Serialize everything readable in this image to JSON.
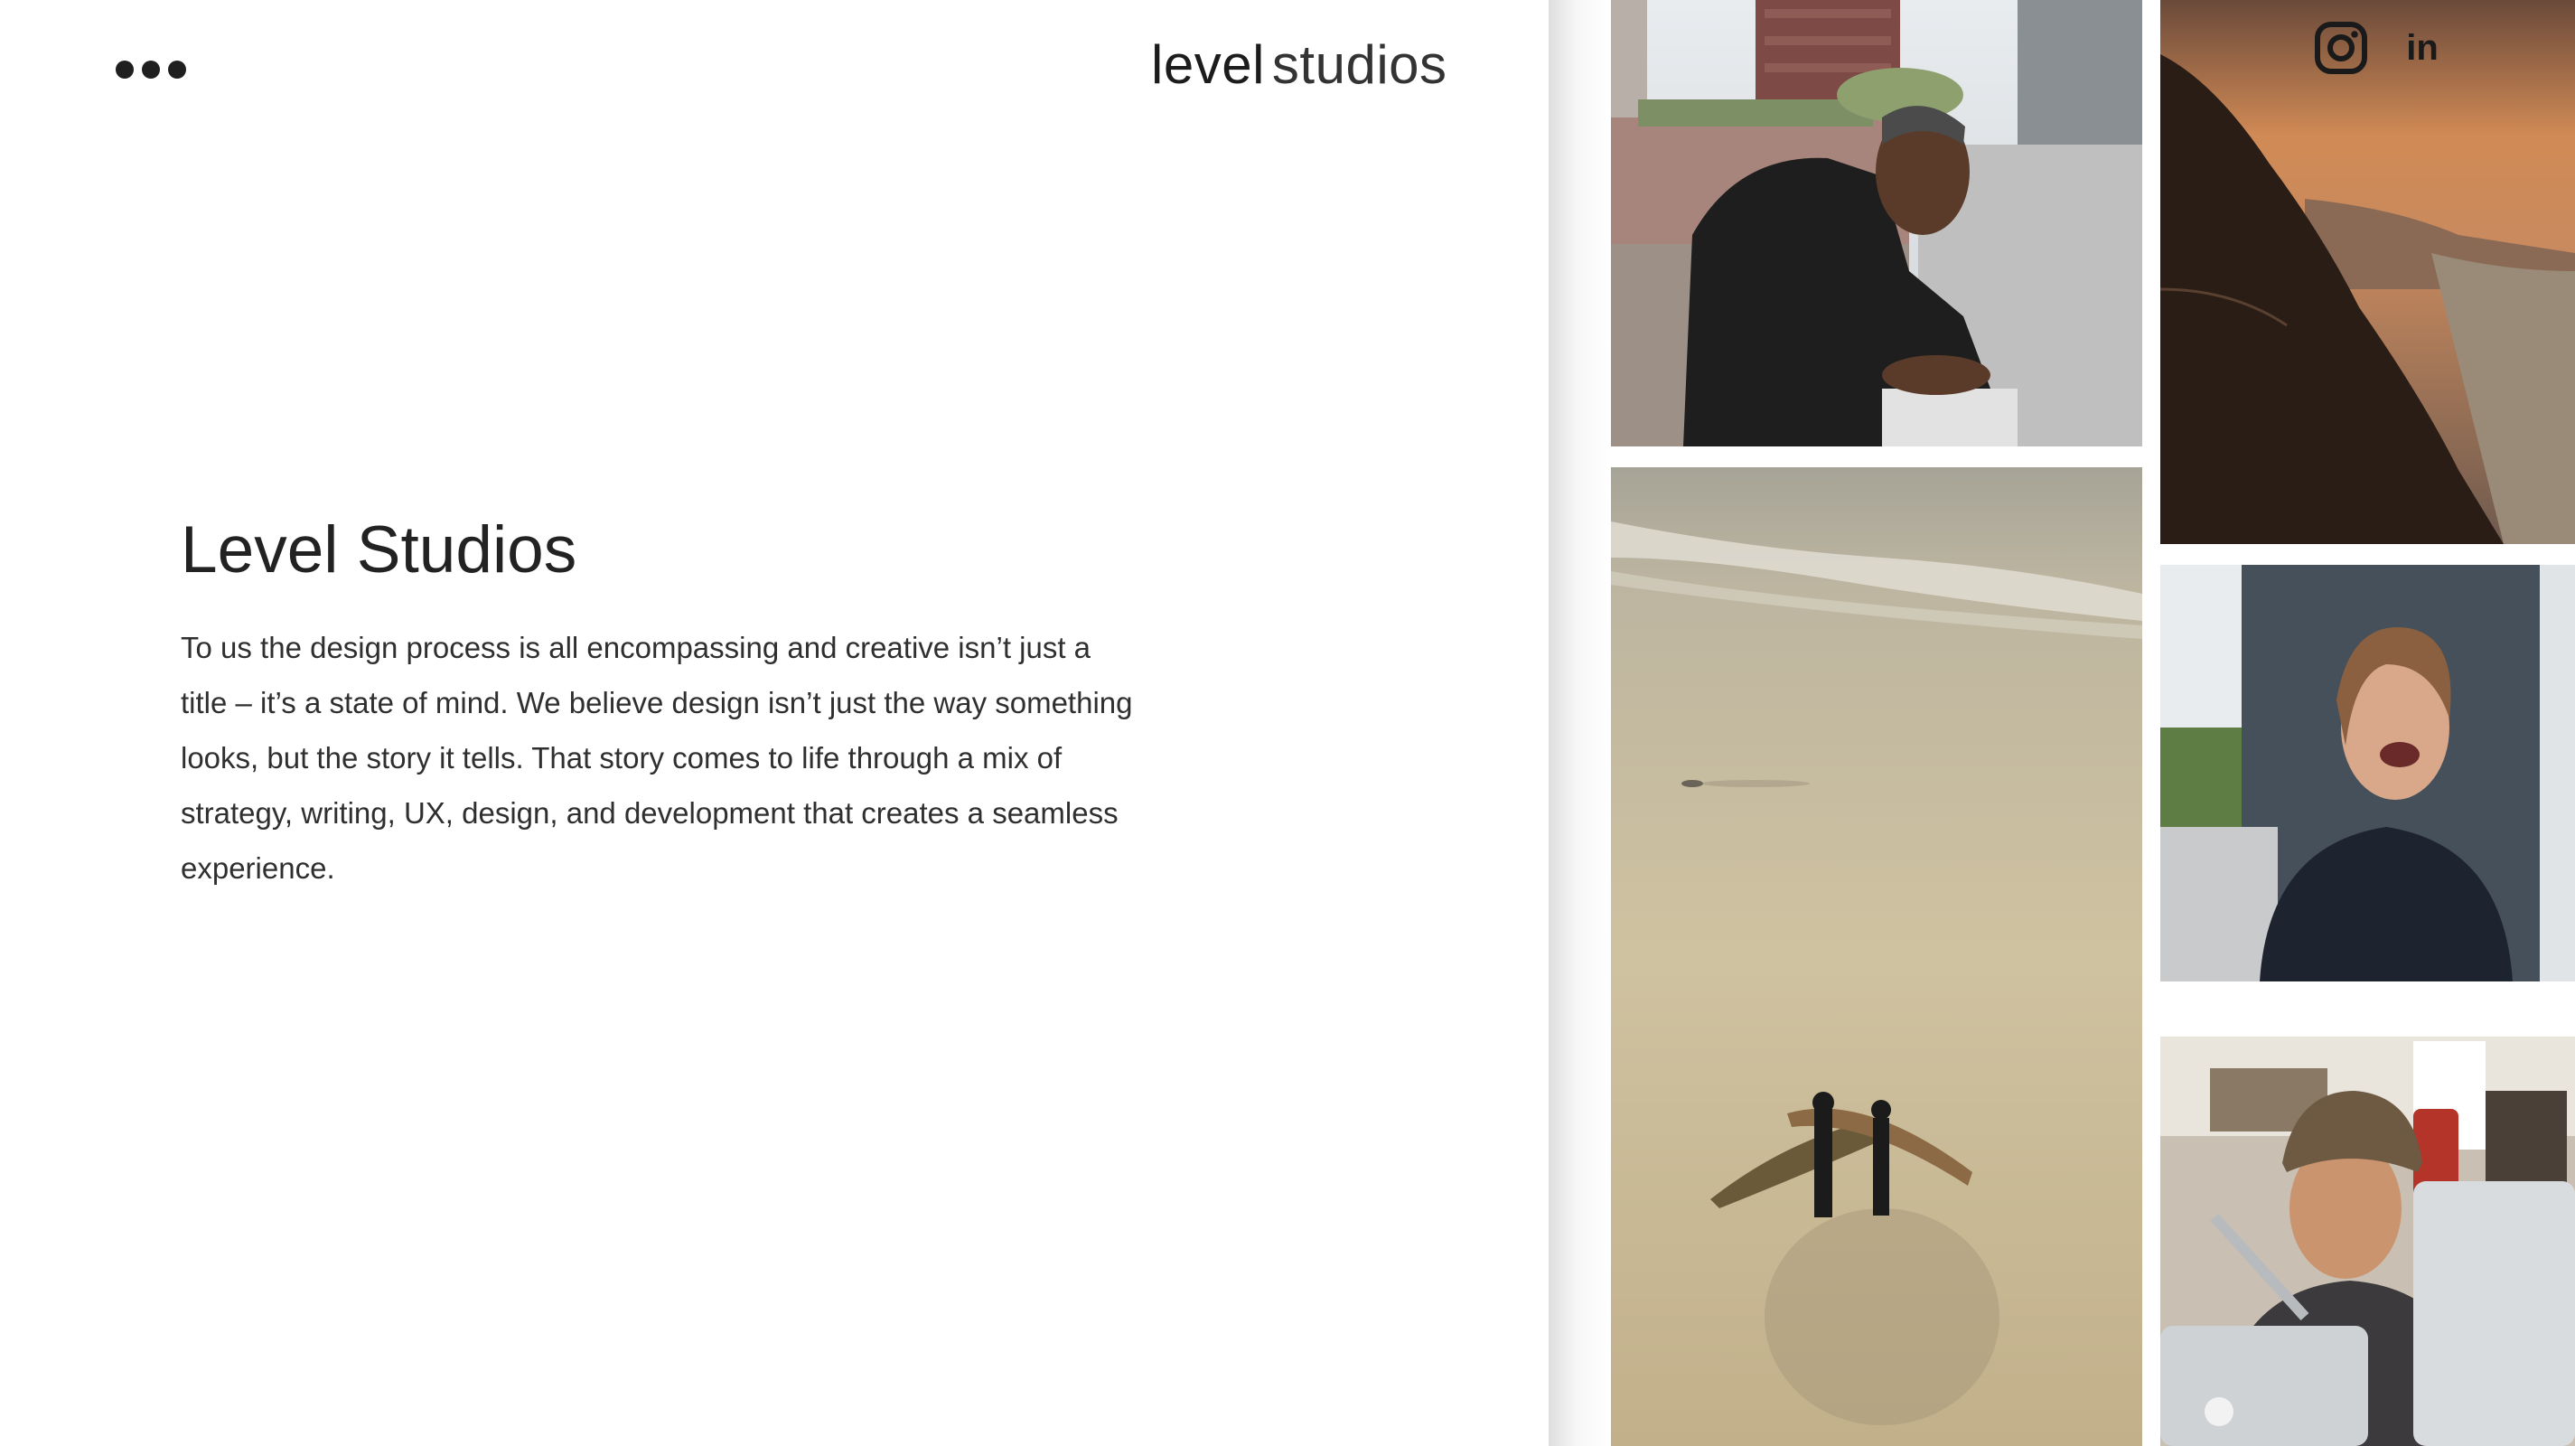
{
  "header": {
    "logo_bold": "level",
    "logo_light": "studios",
    "menu_icon": "more-dots-icon"
  },
  "main": {
    "heading": "Level Studios",
    "body": "To us the design process is all encompassing and creative isn’t just a title – it’s a state of mind. We believe design isn’t just the way something looks, but the story it tells. That story comes to life through a mix of strategy, writing, UX, design, and development that creates a seamless experience."
  },
  "social": {
    "icons": [
      "instagram-icon",
      "linkedin-icon"
    ],
    "linkedin_text": "in"
  },
  "gallery": {
    "photos": [
      "man-on-balcony-photo",
      "surfers-on-beach-photo",
      "coastal-sunset-photo",
      "laughing-woman-photo",
      "man-at-computer-photo"
    ]
  },
  "colors": {
    "text": "#2a2a2a",
    "background": "#ffffff",
    "icon": "#1a1a1a"
  }
}
